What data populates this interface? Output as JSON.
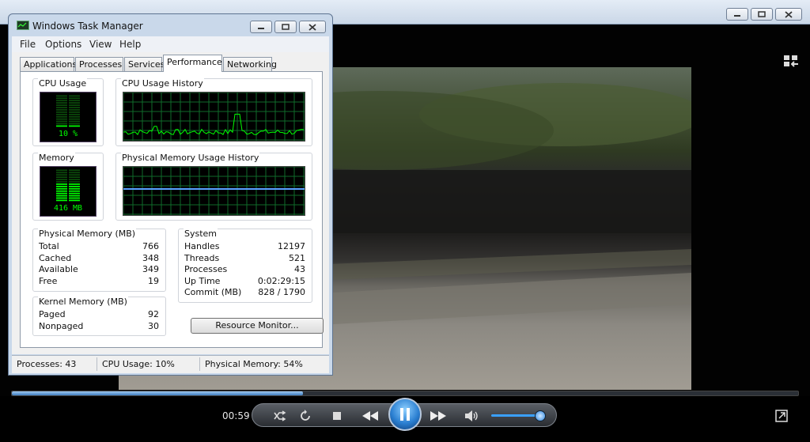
{
  "player": {
    "elapsed_time": "00:59",
    "seek_progress": 0.37,
    "volume_level": 0.95,
    "accent_color": "#3a8fe0"
  },
  "task_manager": {
    "title": "Windows Task Manager",
    "menu": [
      "File",
      "Options",
      "View",
      "Help"
    ],
    "tabs": [
      "Applications",
      "Processes",
      "Services",
      "Performance",
      "Networking"
    ],
    "active_tab": "Performance",
    "cpu_usage": {
      "label": "CPU Usage",
      "value": "10 %",
      "percent": 10
    },
    "cpu_history": {
      "label": "CPU Usage History"
    },
    "memory": {
      "label": "Memory",
      "value": "416 MB",
      "fraction": 0.54
    },
    "memory_history": {
      "label": "Physical Memory Usage History"
    },
    "physical_memory": {
      "label": "Physical Memory (MB)",
      "rows": [
        {
          "k": "Total",
          "v": "766"
        },
        {
          "k": "Cached",
          "v": "348"
        },
        {
          "k": "Available",
          "v": "349"
        },
        {
          "k": "Free",
          "v": "19"
        }
      ]
    },
    "kernel_memory": {
      "label": "Kernel Memory (MB)",
      "rows": [
        {
          "k": "Paged",
          "v": "92"
        },
        {
          "k": "Nonpaged",
          "v": "30"
        }
      ]
    },
    "system": {
      "label": "System",
      "rows": [
        {
          "k": "Handles",
          "v": "12197"
        },
        {
          "k": "Threads",
          "v": "521"
        },
        {
          "k": "Processes",
          "v": "43"
        },
        {
          "k": "Up Time",
          "v": "0:02:29:15"
        },
        {
          "k": "Commit (MB)",
          "v": "828 / 1790"
        }
      ]
    },
    "resource_monitor_button": "Resource Monitor...",
    "status": {
      "processes": "Processes: 43",
      "cpu": "CPU Usage: 10%",
      "memory": "Physical Memory: 54%"
    },
    "graph_color": "#00ff00"
  }
}
